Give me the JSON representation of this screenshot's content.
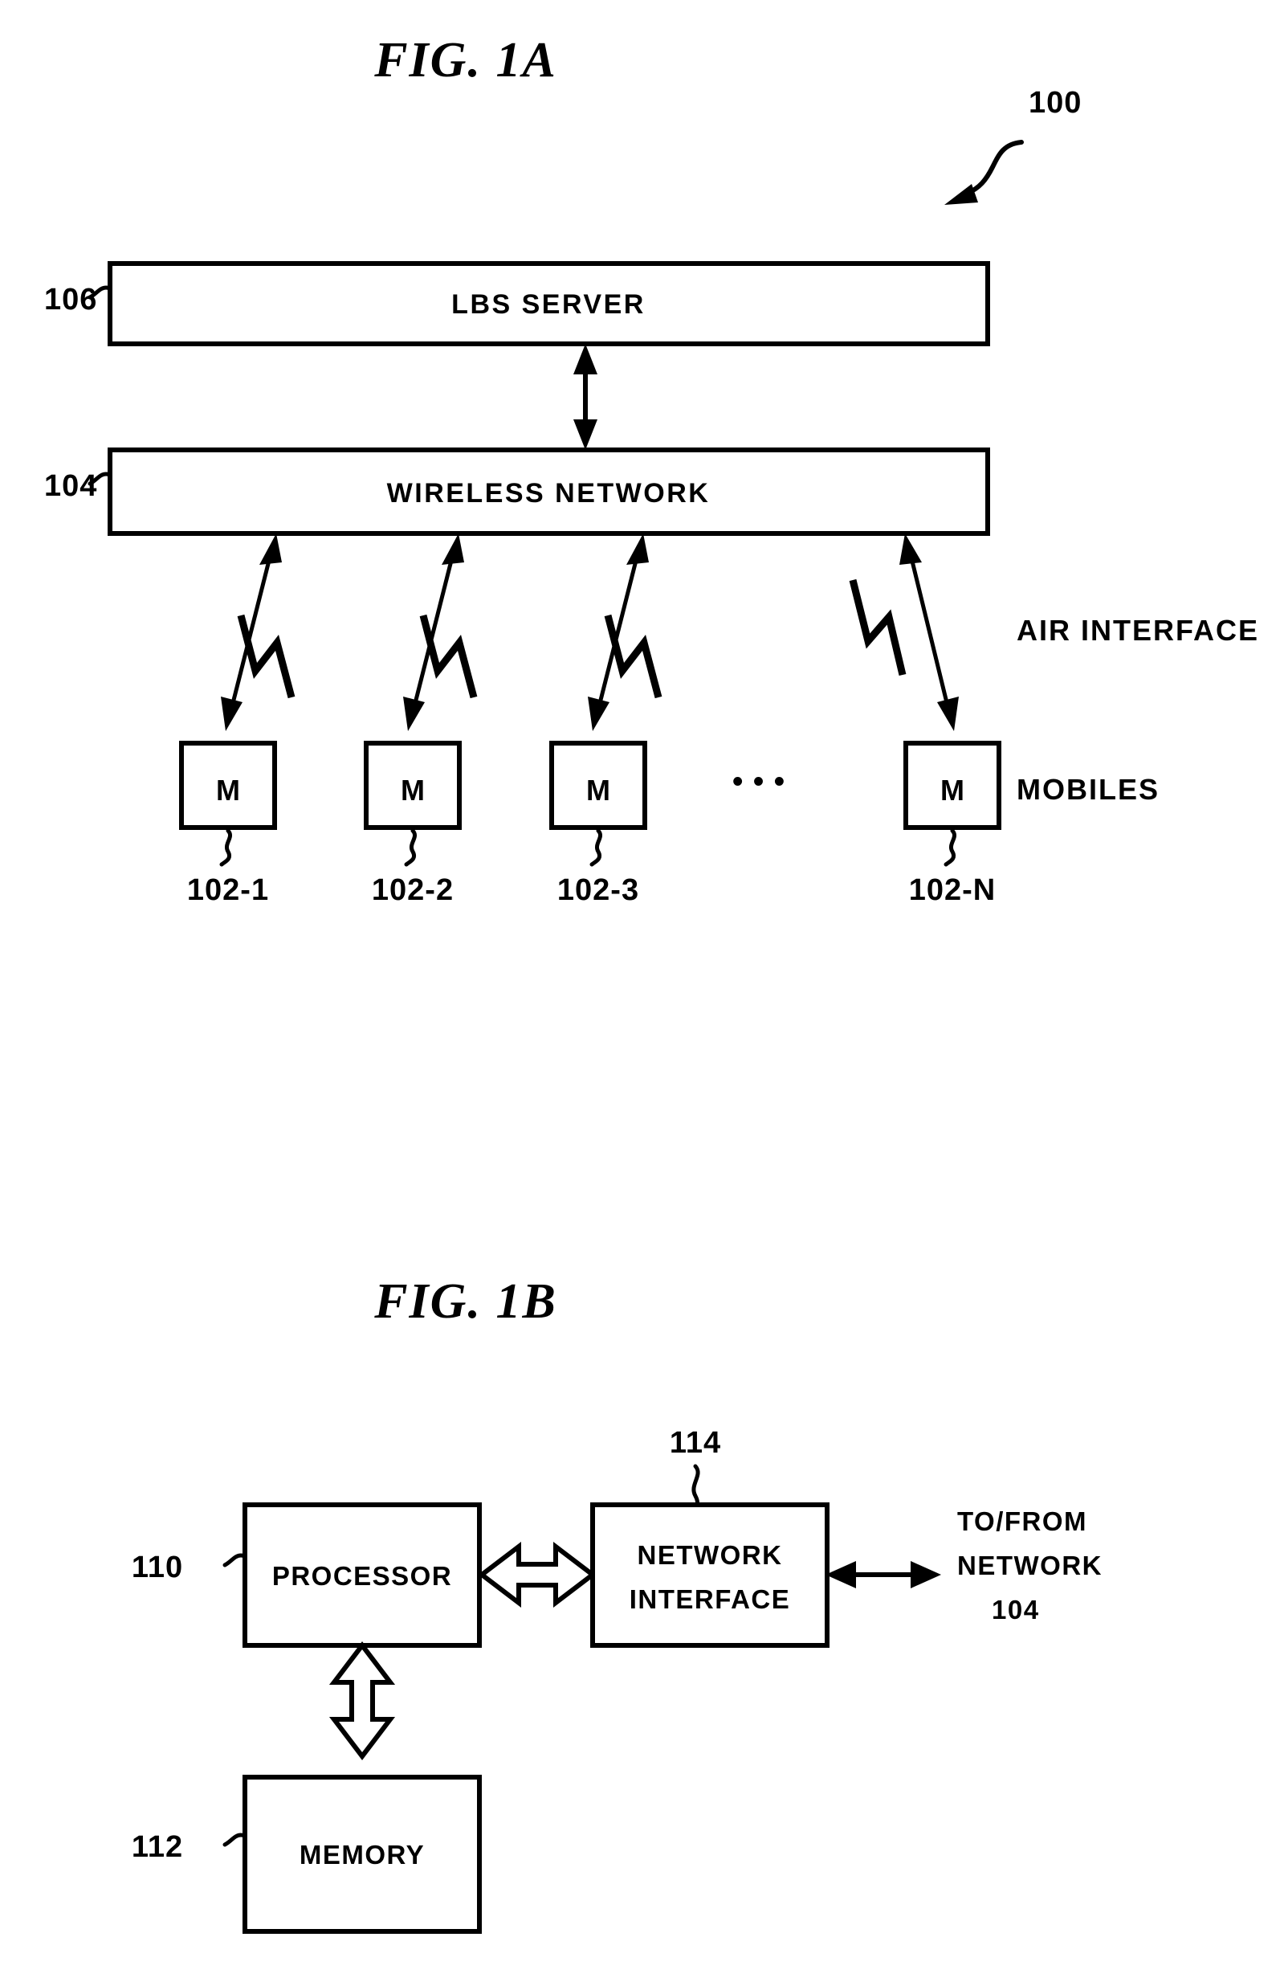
{
  "document": {
    "kind": "patent-figure-sheet",
    "page_background": "#ffffff",
    "ink_color": "#000000"
  },
  "figures": [
    {
      "id": "fig-1a",
      "title": "FIG.  1A",
      "system_ref": "100",
      "boxes": [
        {
          "id": "lbs-server",
          "label": "LBS SERVER",
          "ref": "106"
        },
        {
          "id": "wireless-network",
          "label": "WIRELESS NETWORK",
          "ref": "104"
        }
      ],
      "mobiles": [
        {
          "id": "mobile-1",
          "glyph": "M",
          "ref": "102-1"
        },
        {
          "id": "mobile-2",
          "glyph": "M",
          "ref": "102-2"
        },
        {
          "id": "mobile-3",
          "glyph": "M",
          "ref": "102-3"
        },
        {
          "id": "mobile-n",
          "glyph": "M",
          "ref": "102-N"
        }
      ],
      "ellipsis": "•  •  •",
      "side_labels": {
        "air_interface": "AIR INTERFACE",
        "mobiles": "MOBILES"
      }
    },
    {
      "id": "fig-1b",
      "title": "FIG.  1B",
      "boxes": [
        {
          "id": "processor",
          "label": "PROCESSOR",
          "ref": "110"
        },
        {
          "id": "network-interface",
          "label_line1": "NETWORK",
          "label_line2": "INTERFACE",
          "ref": "114"
        },
        {
          "id": "memory",
          "label": "MEMORY",
          "ref": "112"
        }
      ],
      "external_label": {
        "line1": "TO/FROM",
        "line2": "NETWORK",
        "line3": "104"
      }
    }
  ]
}
